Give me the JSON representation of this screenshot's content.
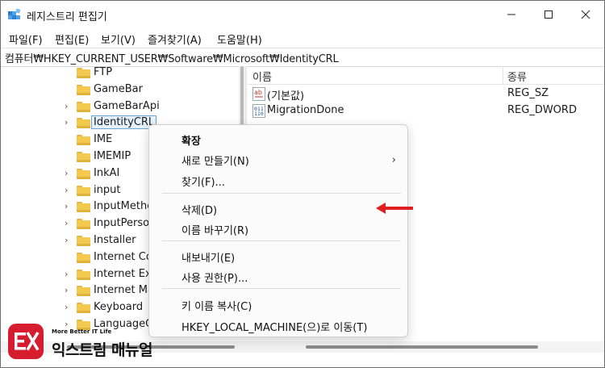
{
  "window": {
    "title": "레지스트리 편집기",
    "controls": {
      "minimize": "minimize-icon",
      "maximize": "maximize-icon",
      "close": "close-icon"
    }
  },
  "menubar": [
    "파일(F)",
    "편집(E)",
    "보기(V)",
    "즐겨찾기(A)",
    "도움말(H)"
  ],
  "address": "컴퓨터₩HKEY_CURRENT_USER₩Software₩Microsoft₩IdentityCRL",
  "tree": {
    "items": [
      {
        "label": "FTP",
        "expandable": false
      },
      {
        "label": "GameBar",
        "expandable": false
      },
      {
        "label": "GameBarApi",
        "expandable": true
      },
      {
        "label": "IdentityCRL",
        "expandable": true,
        "selected": true
      },
      {
        "label": "IME",
        "expandable": false
      },
      {
        "label": "IMEMIP",
        "expandable": false
      },
      {
        "label": "InkAI",
        "expandable": true
      },
      {
        "label": "input",
        "expandable": true
      },
      {
        "label": "InputMethod",
        "expandable": true
      },
      {
        "label": "InputPersona",
        "expandable": true
      },
      {
        "label": "Installer",
        "expandable": true
      },
      {
        "label": "Internet Co",
        "expandable": false
      },
      {
        "label": "Internet Exp",
        "expandable": true
      },
      {
        "label": "Internet Ma",
        "expandable": true
      },
      {
        "label": "Keyboard",
        "expandable": true
      },
      {
        "label": "LanguageC",
        "expandable": true
      }
    ]
  },
  "list": {
    "columns": {
      "name": "이름",
      "type": "종류"
    },
    "rows": [
      {
        "name": "(기본값)",
        "type": "REG_SZ",
        "icon": "string-value-icon"
      },
      {
        "name": "MigrationDone",
        "type": "REG_DWORD",
        "icon": "binary-value-icon"
      }
    ]
  },
  "context_menu": {
    "expand": "확장",
    "new": "새로 만들기(N)",
    "find": "찾기(F)...",
    "delete": "삭제(D)",
    "rename": "이름 바꾸기(R)",
    "export": "내보내기(E)",
    "permissions": "사용 권한(P)...",
    "copy_key_name": "키 이름 복사(C)",
    "goto_hklm": "HKEY_LOCAL_MACHINE(으)로 이동(T)"
  },
  "logo": {
    "tagline": "More Better IT Life",
    "name": "익스트림 매뉴얼"
  },
  "colors": {
    "accent_red": "#d51d2f",
    "arrow_red": "#e02020",
    "folder_yellow": "#f2c94c",
    "selection_blue": "#6aa4d8"
  }
}
